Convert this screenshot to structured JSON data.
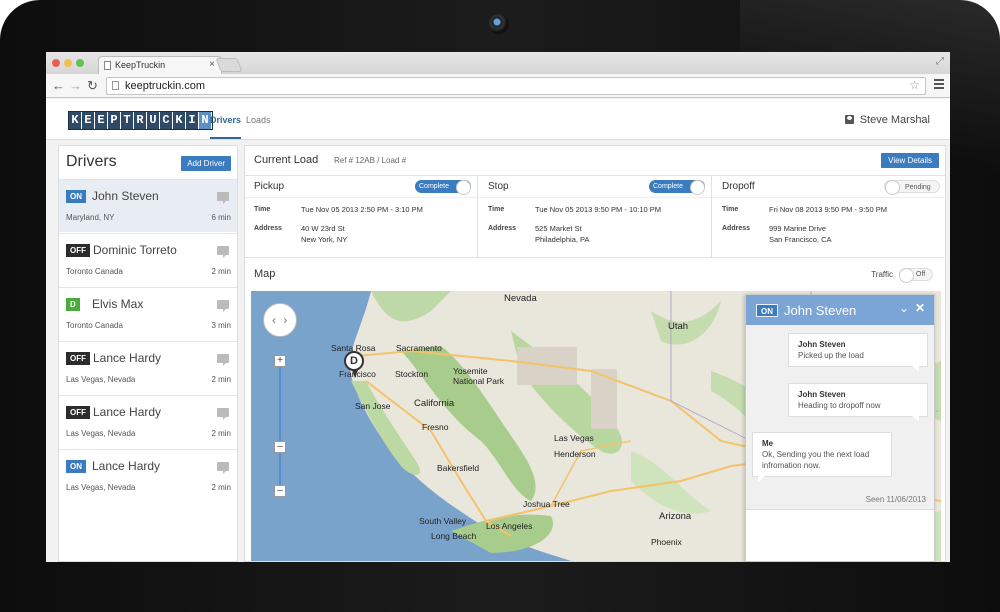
{
  "browser": {
    "tab_title": "KeepTruckin",
    "url": "keeptruckin.com",
    "tab_close": "×"
  },
  "app": {
    "logo_letters": [
      "K",
      "E",
      "E",
      "P",
      "T",
      "R",
      "U",
      "C",
      "K",
      "I",
      "N"
    ],
    "nav": [
      {
        "label": "Drivers",
        "active": true
      },
      {
        "label": "Loads",
        "active": false
      }
    ],
    "user_name": "Steve Marshal"
  },
  "sidebar": {
    "title": "Drivers",
    "add_button": "Add Driver",
    "drivers": [
      {
        "status": "ON",
        "name": "John Steven",
        "location": "Maryland, NY",
        "time": "6 min"
      },
      {
        "status": "OFF",
        "name": "Dominic Torreto",
        "location": "Toronto Canada",
        "time": "2 min"
      },
      {
        "status": "D",
        "name": "Elvis Max",
        "location": "Toronto Canada",
        "time": "3 min"
      },
      {
        "status": "OFF",
        "name": "Lance Hardy",
        "location": "Las Vegas, Nevada",
        "time": "2 min"
      },
      {
        "status": "OFF",
        "name": "Lance Hardy",
        "location": "Las Vegas, Nevada",
        "time": "2 min"
      },
      {
        "status": "ON",
        "name": "Lance Hardy",
        "location": "Las Vegas, Nevada",
        "time": "2 min"
      }
    ]
  },
  "load": {
    "title": "Current Load",
    "ref": "Ref # 12AB / Load #",
    "view_details": "View Details",
    "time_label": "Time",
    "address_label": "Address",
    "stops": [
      {
        "label": "Pickup",
        "state": "Complete",
        "time": "Tue Nov 05 2013 2:50 PM - 3:10 PM",
        "address_line1": "40 W 23rd St",
        "address_line2": "New York, NY"
      },
      {
        "label": "Stop",
        "state": "Complete",
        "time": "Tue Nov 05 2013 9:50 PM - 10:10 PM",
        "address_line1": "525 Market St",
        "address_line2": "Philadelphia, PA"
      },
      {
        "label": "Dropoff",
        "state": "Pending",
        "time": "Fri Nov 08 2013 9:50 PM - 9:50 PM",
        "address_line1": "999 Marine Drive",
        "address_line2": "San Francisco, CA"
      }
    ]
  },
  "map": {
    "title": "Map",
    "traffic_label": "Traffic",
    "traffic_state": "Off",
    "pin_letter": "D",
    "places": {
      "nevada": "Nevada",
      "utah": "Utah",
      "santa_rosa": "Santa Rosa",
      "sacramento": "Sacramento",
      "francisco": "Francisco",
      "stockton": "Stockton",
      "yosemite": "Yosemite",
      "national_park": "National Park",
      "san_jose": "San Jose",
      "california": "California",
      "fresno": "Fresno",
      "las_vegas": "Las Vegas",
      "henderson": "Henderson",
      "bakersfield": "Bakersfield",
      "joshua_tree": "Joshua Tree",
      "south_valley": "South Valley",
      "los_angeles": "Los Angeles",
      "long_beach": "Long Beach",
      "arizona": "Arizona",
      "phoenix": "Phoenix"
    }
  },
  "chat": {
    "status": "ON",
    "name": "John Steven",
    "messages": [
      {
        "from": "John Steven",
        "text": "Picked up the load"
      },
      {
        "from": "John Steven",
        "text": "Heading to dropoff now"
      },
      {
        "from": "Me",
        "text": "Ok, Sending you the next load infromation now."
      }
    ],
    "seen": "Seen 11/06/2013"
  },
  "colors": {
    "accent": "#3b7bbf",
    "status_on": "#3a7bbf",
    "status_off": "#2c2c2c",
    "status_d": "#4bab3d",
    "chat_header": "#7ba5d6"
  }
}
